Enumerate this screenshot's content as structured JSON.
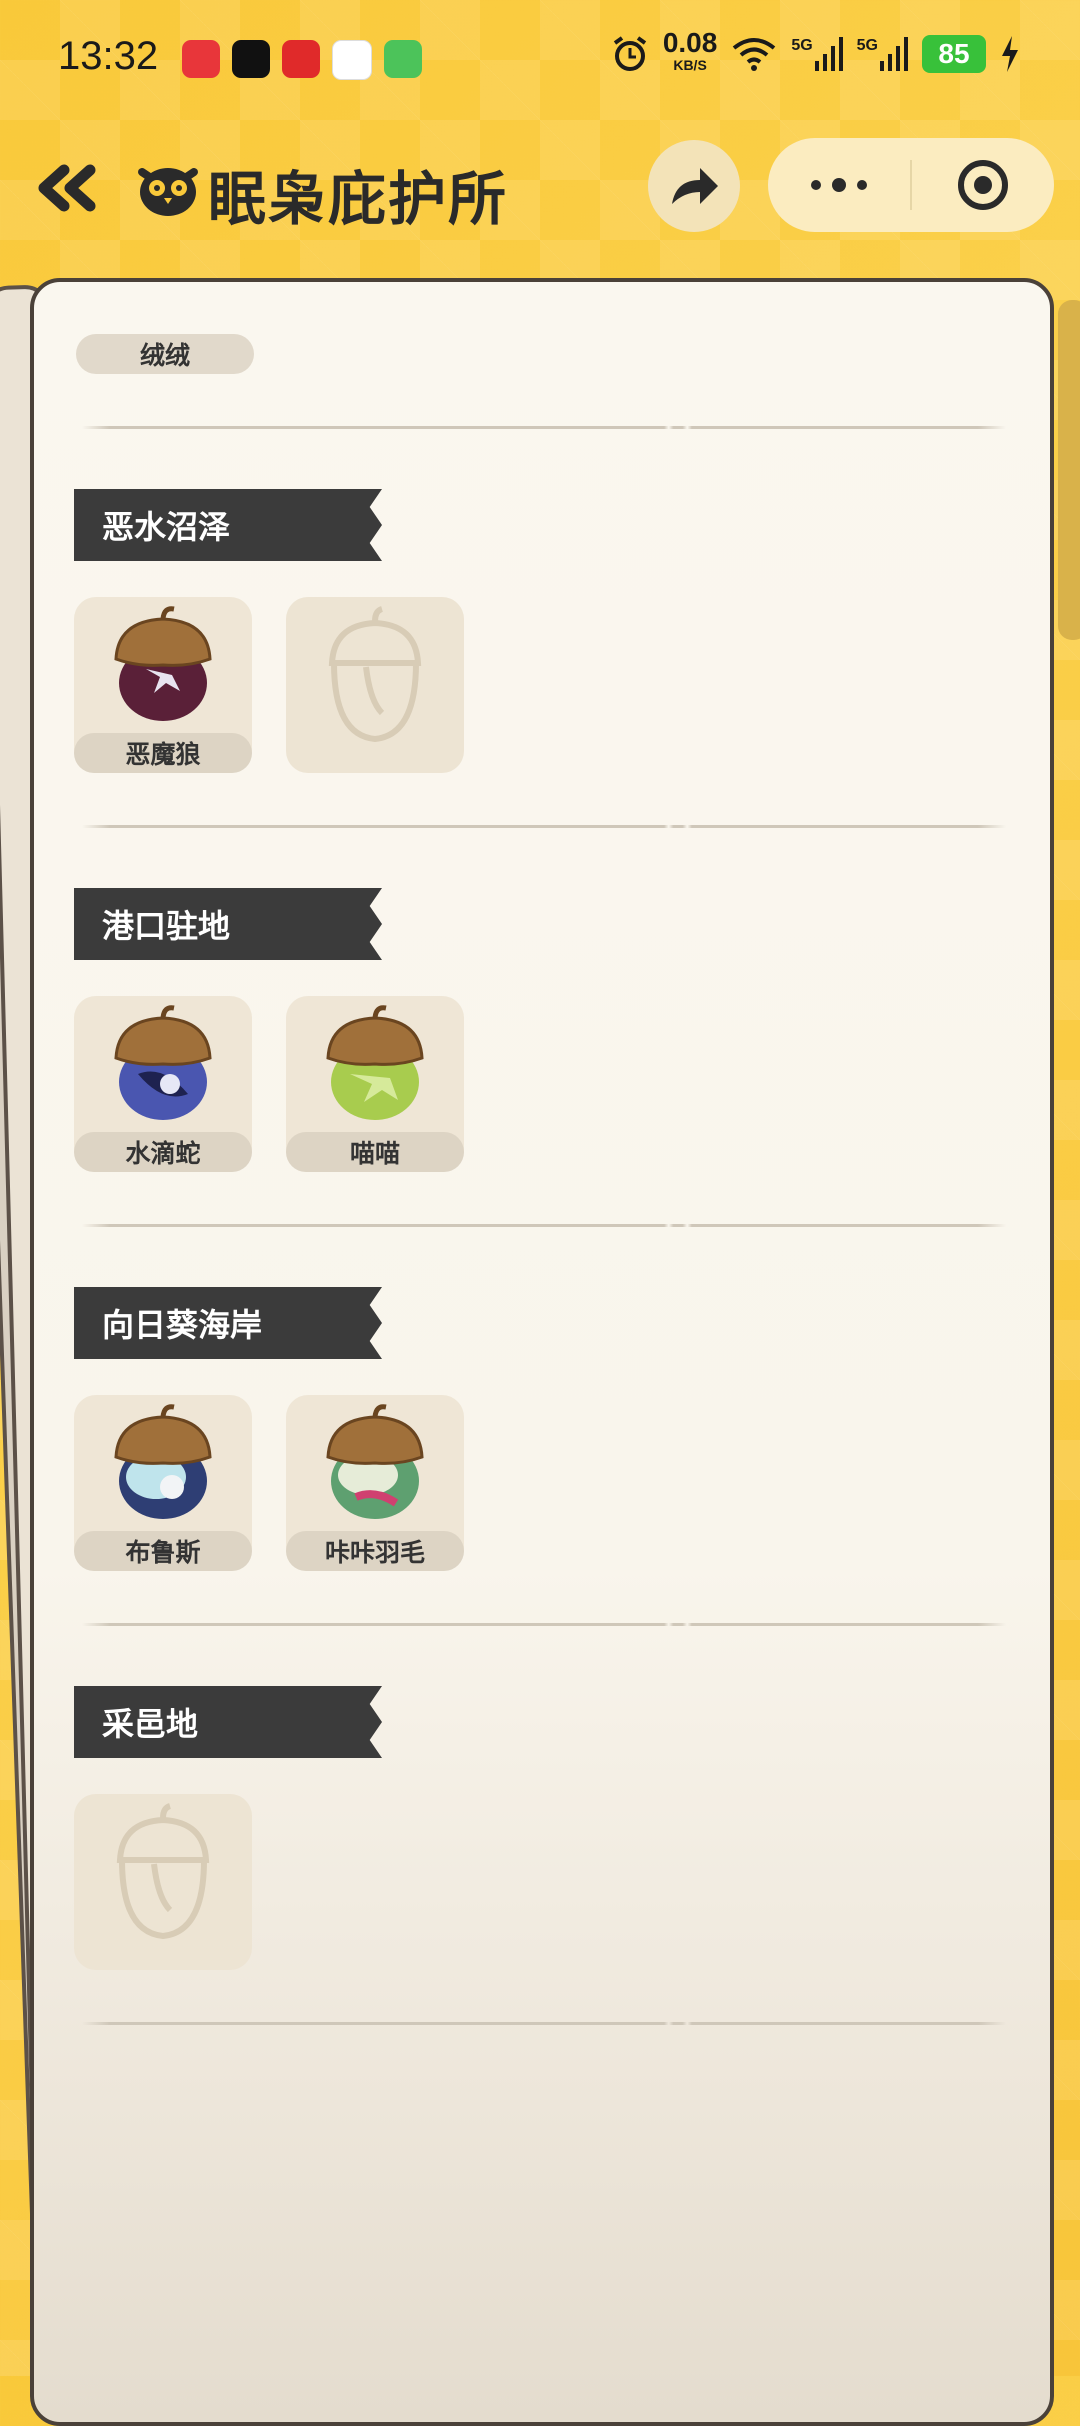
{
  "status_bar": {
    "time": "13:32",
    "net_speed": "0.08",
    "net_unit": "KB/S",
    "sim1": "5G",
    "sim2": "5G",
    "battery": "85"
  },
  "header": {
    "title": "眠枭庇护所",
    "back_icon": "double-chevron-left-icon",
    "share_icon": "share-icon",
    "more_icon": "more-dots-icon",
    "close_icon": "target-circle-icon"
  },
  "top_item": {
    "name": "绒绒"
  },
  "sections": [
    {
      "label": "恶水沼泽",
      "items": [
        {
          "name": "恶魔狼",
          "color": "#5a2038",
          "collected": true
        },
        {
          "name": "",
          "collected": false
        }
      ]
    },
    {
      "label": "港口驻地",
      "items": [
        {
          "name": "水滴蛇",
          "color": "#4a56b0",
          "collected": true
        },
        {
          "name": "喵喵",
          "color": "#a8cc4e",
          "collected": true
        }
      ]
    },
    {
      "label": "向日葵海岸",
      "items": [
        {
          "name": "布鲁斯",
          "color": "#2e3e74",
          "collected": true
        },
        {
          "name": "咔咔羽毛",
          "color": "#5ea070",
          "collected": true
        }
      ]
    },
    {
      "label": "采邑地",
      "items": [
        {
          "name": "",
          "collected": false
        }
      ]
    }
  ],
  "colors": {
    "accent": "#f9c93a",
    "dark": "#3b3b3b",
    "card": "#faf7ef"
  }
}
